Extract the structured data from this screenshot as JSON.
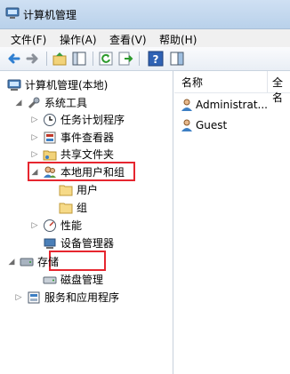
{
  "window": {
    "title": "计算机管理"
  },
  "menubar": {
    "items": [
      {
        "label": "文件(F)"
      },
      {
        "label": "操作(A)"
      },
      {
        "label": "查看(V)"
      },
      {
        "label": "帮助(H)"
      }
    ]
  },
  "toolbar": {
    "buttons": [
      "back-icon",
      "forward-icon",
      "up-folder-icon",
      "show-hide-tree-icon",
      "refresh-icon",
      "export-list-icon",
      "help-icon",
      "properties-pane-icon"
    ]
  },
  "tree": {
    "root": {
      "label": "计算机管理(本地)"
    },
    "system_tools": {
      "label": "系统工具"
    },
    "task_scheduler": {
      "label": "任务计划程序"
    },
    "event_viewer": {
      "label": "事件查看器"
    },
    "shared_folders": {
      "label": "共享文件夹"
    },
    "local_users_groups": {
      "label": "本地用户和组"
    },
    "users": {
      "label": "用户"
    },
    "groups": {
      "label": "组"
    },
    "performance": {
      "label": "性能"
    },
    "device_manager": {
      "label": "设备管理器"
    },
    "storage": {
      "label": "存储"
    },
    "disk_management": {
      "label": "磁盘管理"
    },
    "services_apps": {
      "label": "服务和应用程序"
    }
  },
  "list": {
    "columns": [
      {
        "label": "名称"
      },
      {
        "label": "全名"
      }
    ],
    "rows": [
      {
        "name": "Administrat..."
      },
      {
        "name": "Guest"
      }
    ]
  },
  "colors": {
    "highlight_border": "#e6262f",
    "titlebar": "#b9d1ea"
  }
}
